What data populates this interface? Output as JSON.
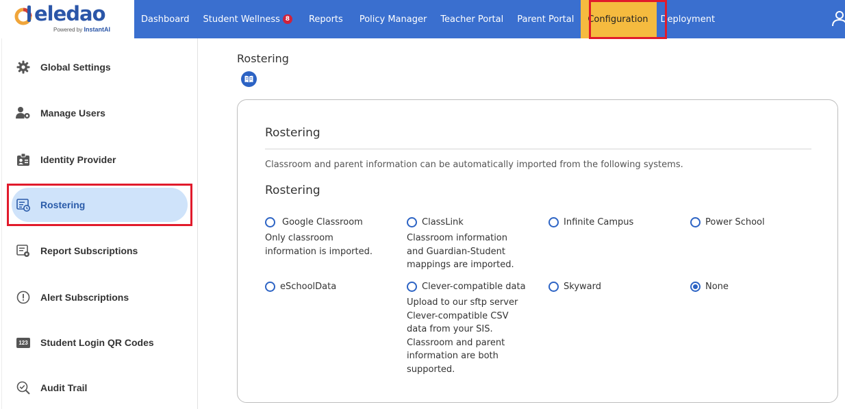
{
  "brand": {
    "name": "eledao",
    "powered_prefix": "Powered by",
    "powered_brand": "InstantAI"
  },
  "nav": {
    "items": [
      {
        "label": "Dashboard"
      },
      {
        "label": "Student Wellness",
        "badge": "8"
      },
      {
        "label": "Reports"
      },
      {
        "label": "Policy Manager"
      },
      {
        "label": "Teacher Portal"
      },
      {
        "label": "Parent Portal"
      },
      {
        "label": "Configuration",
        "active": true
      },
      {
        "label": "Deployment"
      }
    ]
  },
  "sidebar": {
    "items": [
      {
        "label": "Global Settings",
        "icon": "gear-icon"
      },
      {
        "label": "Manage Users",
        "icon": "users-gear-icon"
      },
      {
        "label": "Identity Provider",
        "icon": "id-badge-icon"
      },
      {
        "label": "Rostering",
        "icon": "roster-list-icon",
        "active": true
      },
      {
        "label": "Report Subscriptions",
        "icon": "report-gear-icon"
      },
      {
        "label": "Alert Subscriptions",
        "icon": "alert-circle-icon"
      },
      {
        "label": "Student Login QR Codes",
        "icon": "number-123-icon",
        "icon_text": "123"
      },
      {
        "label": "Audit Trail",
        "icon": "magnifier-check-icon"
      }
    ]
  },
  "main": {
    "title": "Rostering",
    "card": {
      "title": "Rostering",
      "description": "Classroom and parent information can be automatically imported from the following systems.",
      "subtitle": "Rostering",
      "options": [
        {
          "label": "Google Classroom",
          "description": "Only classroom information is imported.",
          "checked": false
        },
        {
          "label": "ClassLink",
          "description": "Classroom information and Guardian-Student mappings are imported.",
          "checked": false
        },
        {
          "label": "Infinite Campus",
          "description": "",
          "checked": false
        },
        {
          "label": "Power School",
          "description": "",
          "checked": false
        },
        {
          "label": "eSchoolData",
          "description": "",
          "checked": false
        },
        {
          "label": "Clever-compatible data",
          "description": "Upload to our sftp server Clever-compatible CSV data from your SIS. Classroom and parent information are both supported.",
          "checked": false
        },
        {
          "label": "Skyward",
          "description": "",
          "checked": false
        },
        {
          "label": "None",
          "description": "",
          "checked": true
        }
      ]
    }
  },
  "colors": {
    "topbar": "#3a6fcf",
    "active_nav": "#f5bb3f",
    "accent": "#2c63c4",
    "sidebar_active": "#cfe3fa",
    "highlight": "#e11a2b"
  }
}
